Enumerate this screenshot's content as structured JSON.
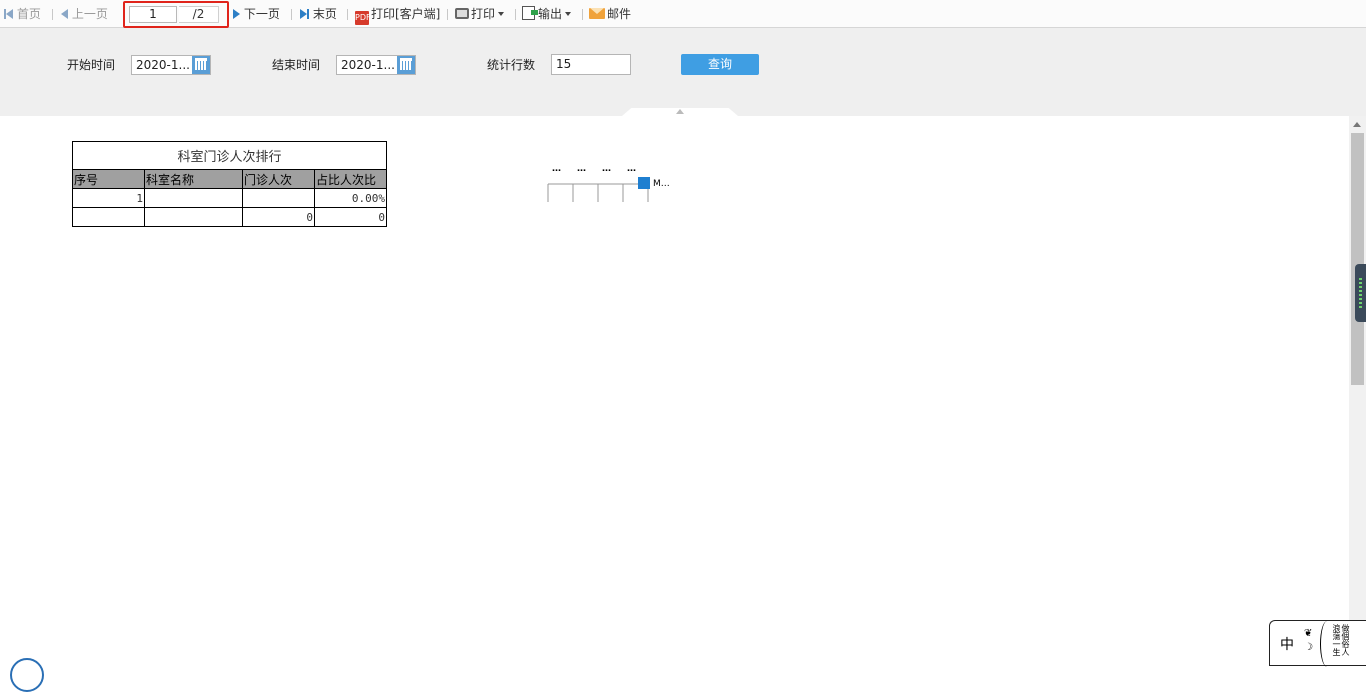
{
  "toolbar": {
    "first_page": "首页",
    "prev_page": "上一页",
    "current_page": "1",
    "total_pages": "/2",
    "next_page": "下一页",
    "last_page": "末页",
    "print_client": "打印[客户端]",
    "print": "打印",
    "export": "输出",
    "mail": "邮件"
  },
  "query": {
    "start_label": "开始时间",
    "start_value": "2020-1...",
    "end_label": "结束时间",
    "end_value": "2020-1...",
    "rows_label": "统计行数",
    "rows_value": "15",
    "submit_label": "查询"
  },
  "report": {
    "title": "科室门诊人次排行",
    "headers": [
      "序号",
      "科室名称",
      "门诊人次",
      "占比人次比"
    ],
    "rows": [
      [
        "1",
        "",
        "",
        "0.00%"
      ],
      [
        "",
        "",
        "0",
        "0"
      ]
    ]
  },
  "chart_data": {
    "type": "bar",
    "title": "",
    "categories": [
      "…",
      "…",
      "…",
      "…"
    ],
    "series": [
      {
        "name": "M…",
        "values": [
          0,
          0,
          0,
          0
        ]
      }
    ],
    "legend_position": "right",
    "series_color": "#1f7fd0"
  },
  "ime": {
    "mode": "中",
    "poem": "做個俗人 浪蕩一生"
  }
}
